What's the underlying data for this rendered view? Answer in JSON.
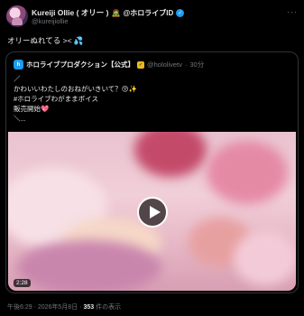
{
  "author": {
    "display_name": "Kureiji Ollie ( オリー )",
    "name_emoji": "🧟",
    "affiliation": "@ホロライブID",
    "handle": "@kureijiollie"
  },
  "tweet_text": "オリーぬれてる >< 💦",
  "quote": {
    "avatar_letter": "h",
    "name": "ホロライブプロダクション【公式】",
    "handle": "@hololivetv",
    "separator": "·",
    "time": "30分",
    "lines": [
      "／",
      "かわいいわたしのおねがいきいて？😚✨",
      "#ホロライブわがままボイス",
      "販売開始💖",
      "＼..."
    ],
    "media": {
      "duration": "2:28"
    }
  },
  "meta": {
    "timestamp": "午後6:29 · 2026年5月8日 · ",
    "views_count": "353",
    "views_label": " 件の表示"
  },
  "colors": {
    "background": "#000000",
    "text": "#e7e9ea",
    "muted": "#71767b",
    "accent": "#1d9bf0",
    "border": "#2f3336"
  },
  "icons": {
    "verified": "verified-check-icon",
    "more": "more-dots-icon",
    "play": "play-icon"
  }
}
